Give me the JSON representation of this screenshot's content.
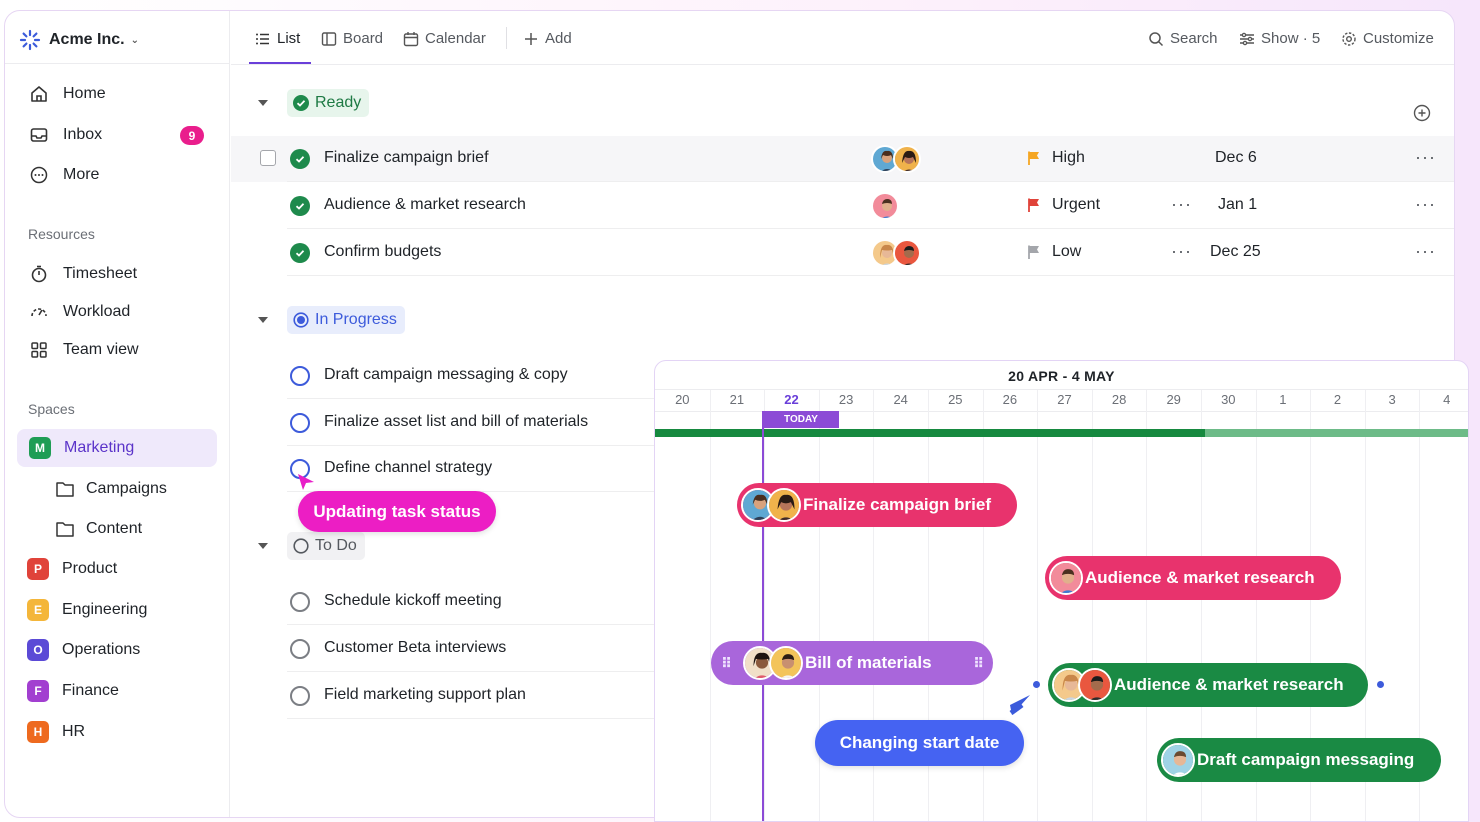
{
  "workspace": {
    "name": "Acme Inc."
  },
  "sidebar": {
    "nav": [
      {
        "label": "Home",
        "icon": "home-icon"
      },
      {
        "label": "Inbox",
        "icon": "inbox-icon",
        "badge": "9"
      },
      {
        "label": "More",
        "icon": "more-icon"
      }
    ],
    "resources_label": "Resources",
    "resources": [
      {
        "label": "Timesheet",
        "icon": "timer-icon"
      },
      {
        "label": "Workload",
        "icon": "gauge-icon"
      },
      {
        "label": "Team view",
        "icon": "grid-icon"
      }
    ],
    "spaces_label": "Spaces",
    "spaces": [
      {
        "letter": "M",
        "label": "Marketing",
        "color": "#1f9d55"
      },
      {
        "letter": "P",
        "label": "Product",
        "color": "#e0433a"
      },
      {
        "letter": "E",
        "label": "Engineering",
        "color": "#f4b63a"
      },
      {
        "letter": "O",
        "label": "Operations",
        "color": "#5b4ad6"
      },
      {
        "letter": "F",
        "label": "Finance",
        "color": "#a23fd0"
      },
      {
        "letter": "H",
        "label": "HR",
        "color": "#ee6a1f"
      }
    ],
    "folders": [
      {
        "label": "Campaigns"
      },
      {
        "label": "Content"
      }
    ]
  },
  "topbar": {
    "tabs": [
      {
        "label": "List",
        "icon": "list-icon"
      },
      {
        "label": "Board",
        "icon": "board-icon"
      },
      {
        "label": "Calendar",
        "icon": "calendar-icon"
      },
      {
        "label": "Add",
        "icon": "plus-icon"
      }
    ],
    "search": "Search",
    "show": "Show · 5",
    "customize": "Customize"
  },
  "groups": {
    "ready": {
      "label": "Ready",
      "color": "#1e8a4c"
    },
    "in_progress": {
      "label": "In Progress",
      "color": "#3d5bdb"
    },
    "todo": {
      "label": "To Do",
      "color": "#55595f"
    }
  },
  "tasks": {
    "ready": [
      {
        "name": "Finalize campaign brief",
        "priority": "High",
        "flag_color": "#f5a623",
        "date": "Dec 6"
      },
      {
        "name": "Audience & market research",
        "priority": "Urgent",
        "flag_color": "#e0433a",
        "date": "Jan 1"
      },
      {
        "name": "Confirm budgets",
        "priority": "Low",
        "flag_color": "#a4a6ab",
        "date": "Dec 25"
      }
    ],
    "in_progress": [
      {
        "name": "Draft campaign messaging & copy"
      },
      {
        "name": "Finalize asset list and bill of materials"
      },
      {
        "name": "Define channel strategy"
      }
    ],
    "todo": [
      {
        "name": "Schedule kickoff meeting"
      },
      {
        "name": "Customer Beta interviews"
      },
      {
        "name": "Field marketing support plan"
      }
    ]
  },
  "bubbles": {
    "status": "Updating task status",
    "start_date": "Changing start date"
  },
  "gantt": {
    "range": "20 APR - 4 MAY",
    "days": [
      "20",
      "21",
      "22",
      "23",
      "24",
      "25",
      "26",
      "27",
      "28",
      "29",
      "30",
      "1",
      "2",
      "3",
      "4"
    ],
    "today_label": "TODAY",
    "bars": [
      {
        "label": "Finalize campaign brief",
        "color": "#e8336d"
      },
      {
        "label": "Audience & market research",
        "color": "#e8336d"
      },
      {
        "label": "Bill of materials",
        "color": "#a966db"
      },
      {
        "label": "Audience & market research",
        "color": "#1a8a44"
      },
      {
        "label": "Draft campaign messaging",
        "color": "#1a8a44"
      }
    ]
  }
}
